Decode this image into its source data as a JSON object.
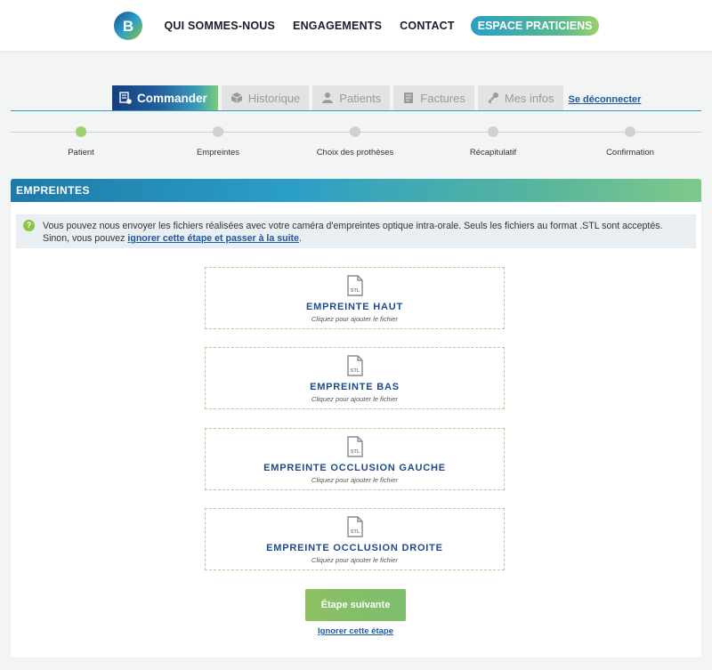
{
  "header": {
    "logo_letter": "B",
    "nav": [
      "QUI SOMMES-NOUS",
      "ENGAGEMENTS",
      "CONTACT"
    ],
    "cta": "ESPACE PRATICIENS"
  },
  "tabs": [
    {
      "label": "Commander",
      "icon": "cart-icon",
      "active": true
    },
    {
      "label": "Historique",
      "icon": "box-icon",
      "active": false
    },
    {
      "label": "Patients",
      "icon": "user-icon",
      "active": false
    },
    {
      "label": "Factures",
      "icon": "invoice-icon",
      "active": false
    },
    {
      "label": "Mes infos",
      "icon": "key-icon",
      "active": false
    }
  ],
  "logout_label": "Se déconnecter",
  "steps": [
    {
      "label": "Patient",
      "current": true
    },
    {
      "label": "Empreintes",
      "current": false
    },
    {
      "label": "Choix des prothèses",
      "current": false
    },
    {
      "label": "Récapitulatif",
      "current": false
    },
    {
      "label": "Confirmation",
      "current": false
    }
  ],
  "section": {
    "title": "EMPREINTES",
    "info_line1": "Vous pouvez nous envoyer les fichiers réalisées avec votre caméra d'empreintes optique intra-orale. Seuls les fichiers au format .STL sont acceptés.",
    "info_line2_prefix": "Sinon, vous pouvez ",
    "info_link": "ignorer cette étape et passer à la suite",
    "info_line2_suffix": "."
  },
  "uploads": [
    {
      "title": "EMPREINTE HAUT",
      "hint": "Cliquez pour ajouter le fichier"
    },
    {
      "title": "EMPREINTE BAS",
      "hint": "Cliquez pour ajouter le fichier"
    },
    {
      "title": "EMPREINTE OCCLUSION GAUCHE",
      "hint": "Cliquez pour ajouter le fichier"
    },
    {
      "title": "EMPREINTE OCCLUSION DROITE",
      "hint": "Cliquez pour ajouter le fichier"
    }
  ],
  "file_icon_text": "STL",
  "buttons": {
    "next": "Étape suivante",
    "skip": "Ignorer cette étape"
  },
  "colors": {
    "accent_blue": "#2a9ec7",
    "accent_green": "#8cc063",
    "title_blue": "#1f4a8a"
  }
}
